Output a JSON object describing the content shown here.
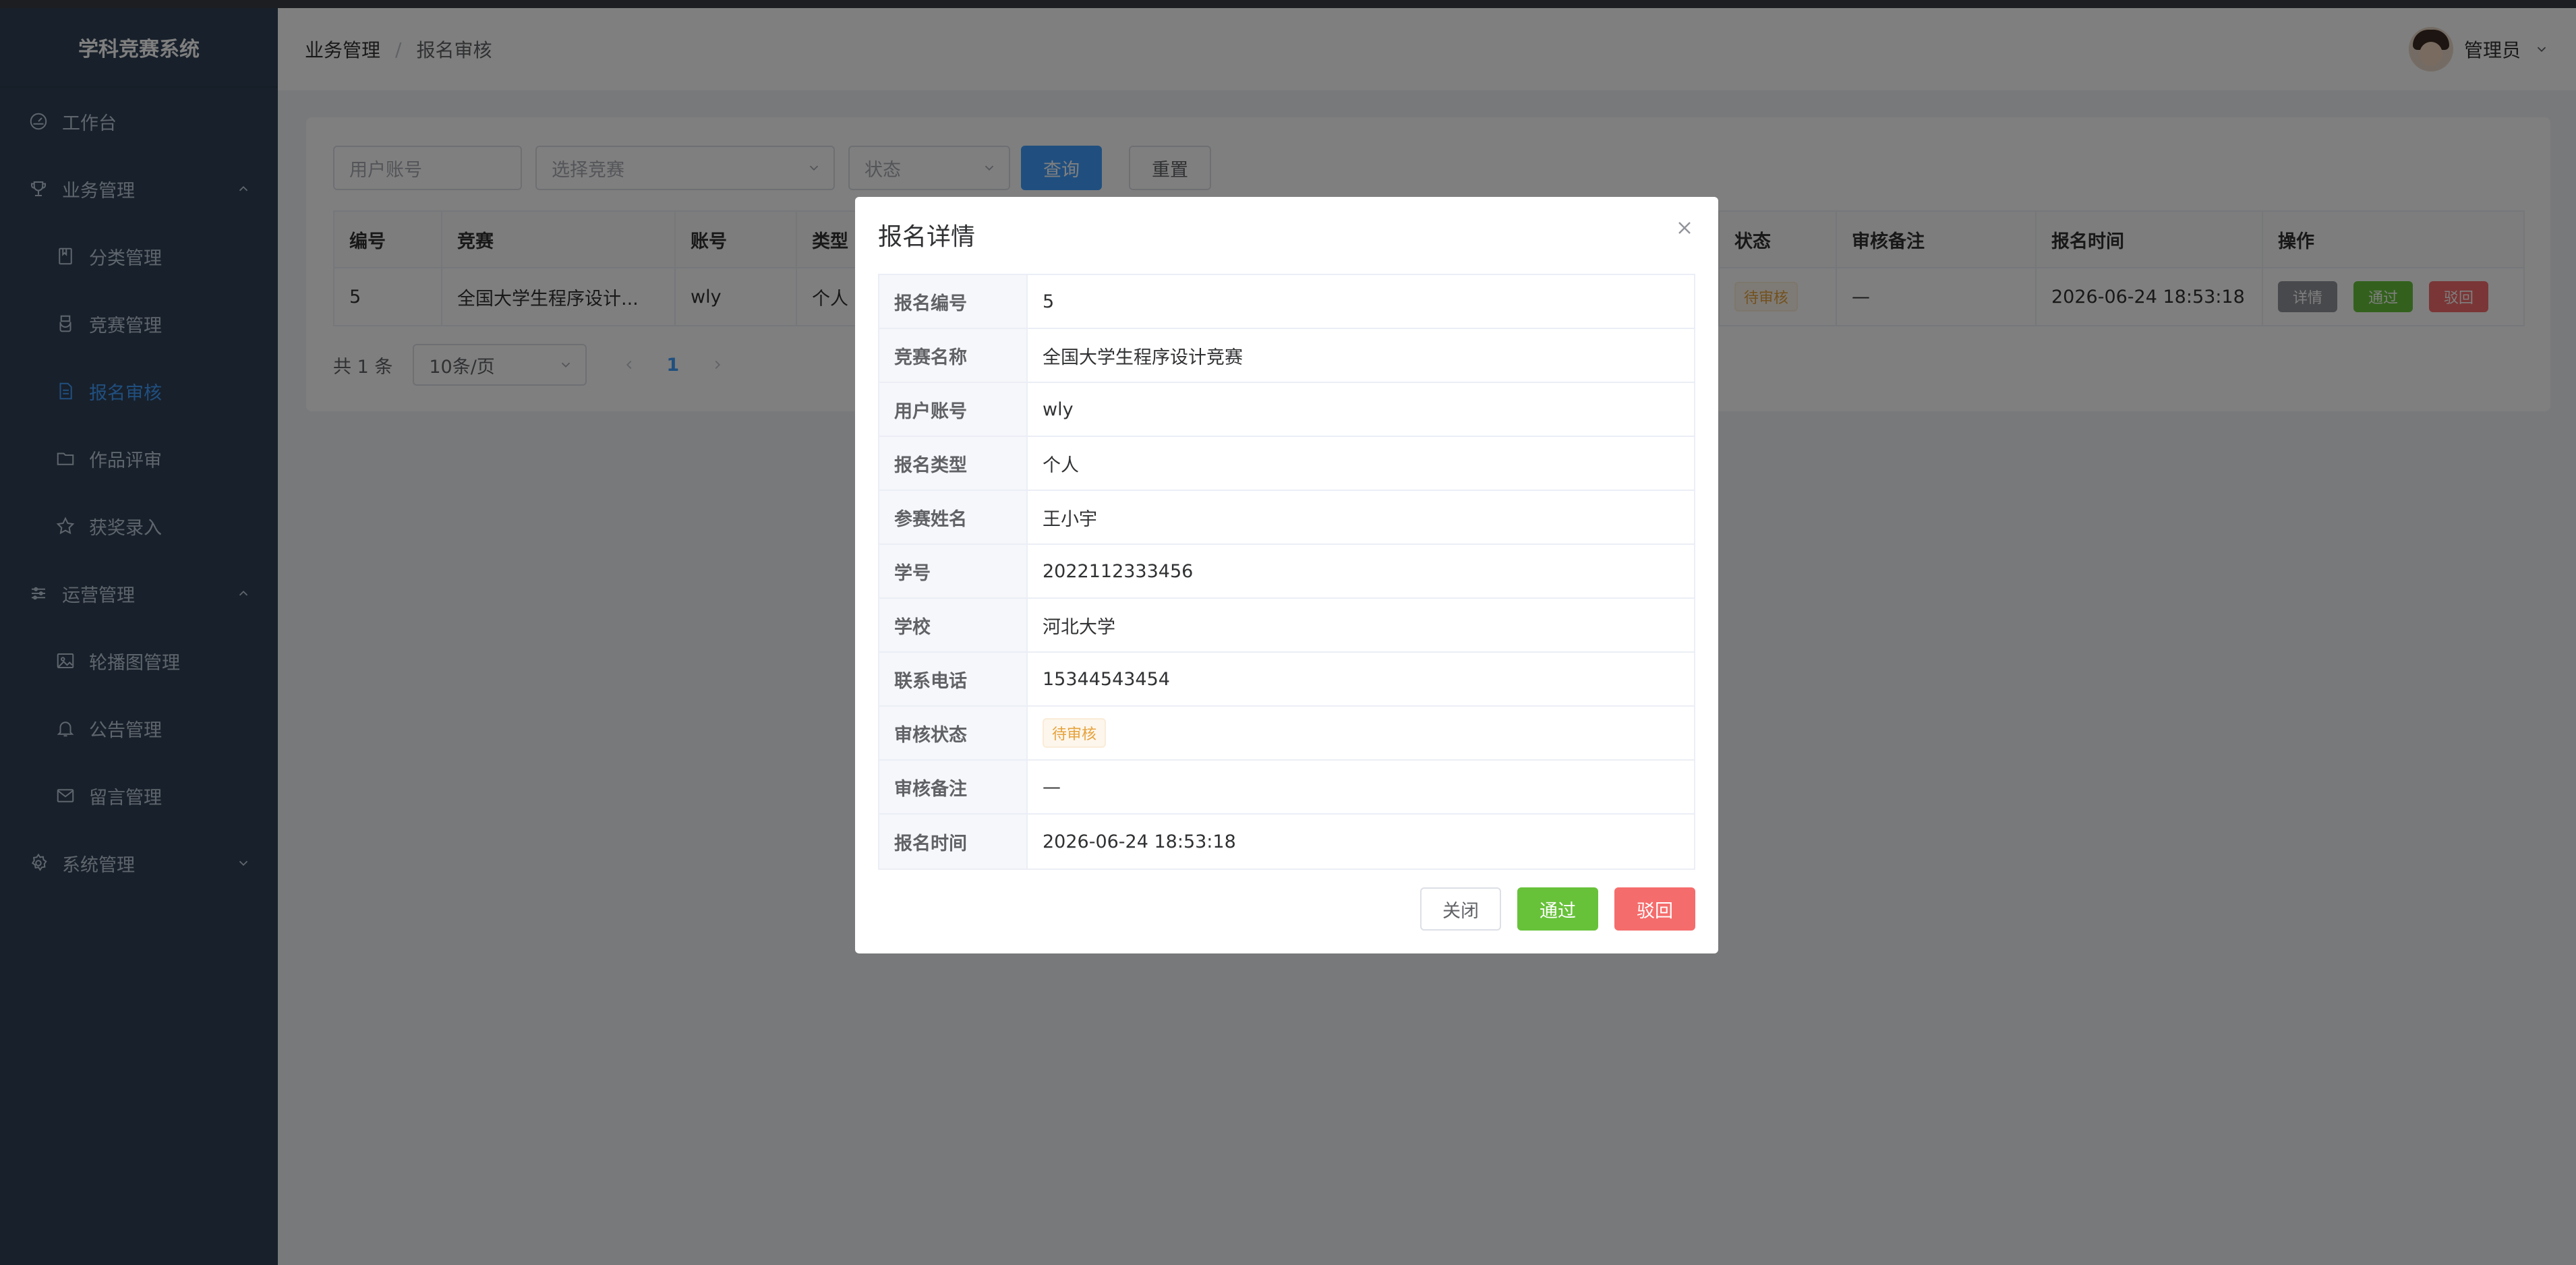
{
  "app": {
    "title": "学科竞赛系统"
  },
  "sidebar": {
    "items": [
      {
        "label": "工作台",
        "icon": "dashboard-icon"
      },
      {
        "label": "业务管理",
        "icon": "trophy-icon",
        "expanded": true
      },
      {
        "label": "分类管理",
        "icon": "bookmark-icon"
      },
      {
        "label": "竞赛管理",
        "icon": "medal-icon"
      },
      {
        "label": "报名审核",
        "icon": "document-icon",
        "active": true
      },
      {
        "label": "作品评审",
        "icon": "folder-icon"
      },
      {
        "label": "获奖录入",
        "icon": "star-icon"
      },
      {
        "label": "运营管理",
        "icon": "sliders-icon",
        "expanded": true
      },
      {
        "label": "轮播图管理",
        "icon": "picture-icon"
      },
      {
        "label": "公告管理",
        "icon": "bell-icon"
      },
      {
        "label": "留言管理",
        "icon": "message-icon"
      },
      {
        "label": "系统管理",
        "icon": "gear-icon",
        "expanded": false
      }
    ]
  },
  "header": {
    "breadcrumb": [
      "业务管理",
      "报名审核"
    ],
    "separator": "/",
    "user_name": "管理员"
  },
  "filters": {
    "account_placeholder": "用户账号",
    "competition_placeholder": "选择竞赛",
    "status_placeholder": "状态",
    "search_label": "查询",
    "reset_label": "重置"
  },
  "table": {
    "columns": [
      "编号",
      "竞赛",
      "账号",
      "类型",
      "状态",
      "审核备注",
      "报名时间",
      "操作"
    ],
    "rows": [
      {
        "id": "5",
        "competition": "全国大学生程序设计...",
        "account": "wly",
        "type": "个人",
        "status": "待审核",
        "remark": "—",
        "time": "2026-06-24 18:53:18",
        "actions": [
          "详情",
          "通过",
          "驳回"
        ]
      }
    ]
  },
  "pagination": {
    "total_text": "共 1 条",
    "page_size": "10条/页",
    "current_page": "1"
  },
  "dialog": {
    "title": "报名详情",
    "fields": [
      {
        "label": "报名编号",
        "value": "5"
      },
      {
        "label": "竞赛名称",
        "value": "全国大学生程序设计竞赛"
      },
      {
        "label": "用户账号",
        "value": "wly"
      },
      {
        "label": "报名类型",
        "value": "个人"
      },
      {
        "label": "参赛姓名",
        "value": "王小宇"
      },
      {
        "label": "学号",
        "value": "2022112333456"
      },
      {
        "label": "学校",
        "value": "河北大学"
      },
      {
        "label": "联系电话",
        "value": "15344543454"
      },
      {
        "label": "审核状态",
        "value": "待审核"
      },
      {
        "label": "审核备注",
        "value": "—"
      },
      {
        "label": "报名时间",
        "value": "2026-06-24 18:53:18"
      }
    ],
    "close_label": "关闭",
    "pass_label": "通过",
    "reject_label": "驳回"
  },
  "colors": {
    "sidebar_bg": "#304156",
    "active": "#409eff",
    "primary": "#409eff",
    "success": "#67c23a",
    "danger": "#f56c6c",
    "info": "#909399",
    "warning": "#e6a23c"
  }
}
